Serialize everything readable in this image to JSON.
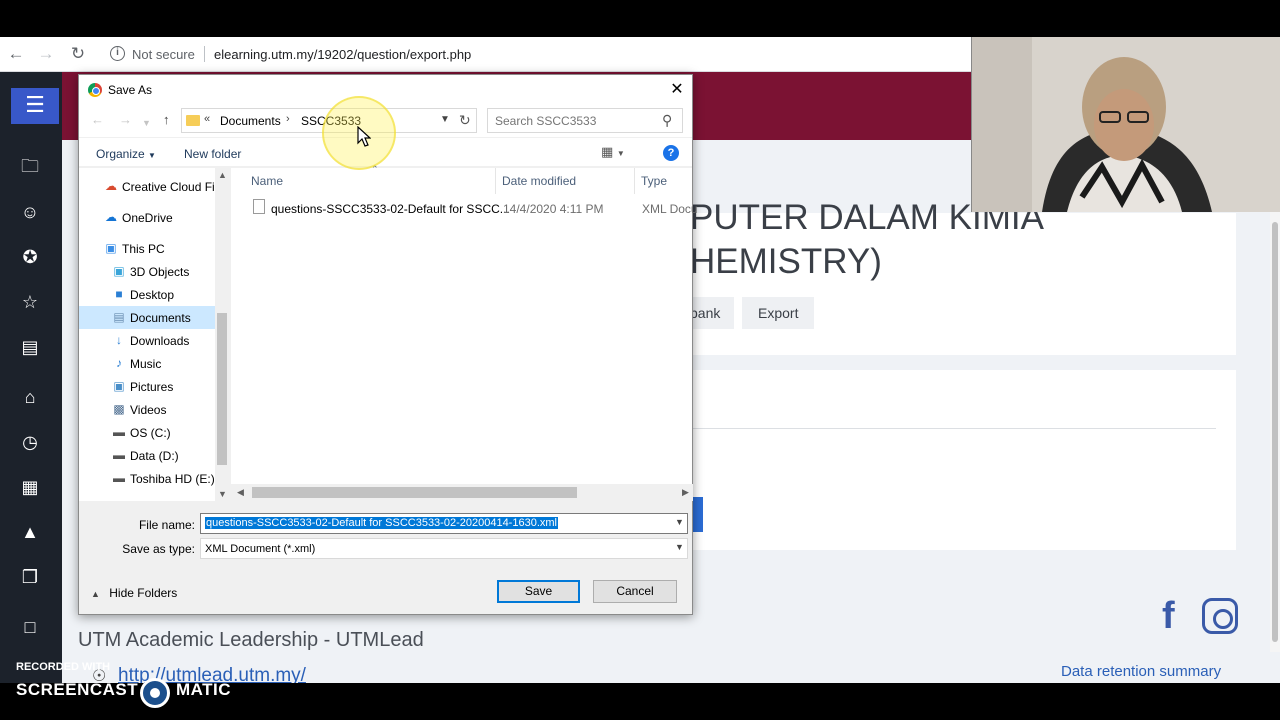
{
  "browser": {
    "back_icon": "back-arrow-icon",
    "forward_icon": "forward-arrow-icon",
    "reload_icon": "reload-icon",
    "security_label": "Not secure",
    "url": "elearning.utm.my/19202/question/export.php"
  },
  "site": {
    "header_color": "#7b1233",
    "course_title_line1": "PUTER DALAM KIMIA",
    "course_title_line2": "HEMISTRY)",
    "breadcrumb_bank": "bank",
    "breadcrumb_export": "Export",
    "footer_title": "UTM Academic Leadership - UTMLead",
    "footer_link": "http://utmlead.utm.my/",
    "data_retention": "Data retention summary",
    "rail_icons": [
      "folder-icon",
      "user-search-icon",
      "badge-icon",
      "star-icon",
      "book-icon",
      "home-icon",
      "dashboard-icon",
      "calendar-icon",
      "graduation-icon",
      "copy-icon",
      "folder-icon"
    ]
  },
  "dialog": {
    "title": "Save As",
    "path": {
      "chevrons": "«",
      "crumb1": "Documents",
      "separator": "›",
      "crumb2": "SSCC3533"
    },
    "search_placeholder": "Search SSCC3533",
    "toolbar": {
      "organize": "Organize",
      "new_folder": "New folder",
      "help": "?"
    },
    "nav_items": [
      {
        "label": "Creative Cloud Fil",
        "icon": "creative-cloud-icon"
      },
      {
        "label": "OneDrive",
        "icon": "onedrive-icon"
      },
      {
        "label": "This PC",
        "icon": "computer-icon"
      },
      {
        "label": "3D Objects",
        "icon": "cube-icon"
      },
      {
        "label": "Desktop",
        "icon": "desktop-icon"
      },
      {
        "label": "Documents",
        "icon": "document-icon"
      },
      {
        "label": "Downloads",
        "icon": "download-icon"
      },
      {
        "label": "Music",
        "icon": "music-icon"
      },
      {
        "label": "Pictures",
        "icon": "pictures-icon"
      },
      {
        "label": "Videos",
        "icon": "videos-icon"
      },
      {
        "label": "OS (C:)",
        "icon": "drive-icon"
      },
      {
        "label": "Data (D:)",
        "icon": "drive-icon"
      },
      {
        "label": "Toshiba HD (E:)",
        "icon": "drive-icon"
      }
    ],
    "columns": {
      "name": "Name",
      "date": "Date modified",
      "type": "Type"
    },
    "files": [
      {
        "name": "questions-SSCC3533-02-Default for SSCC...",
        "date": "14/4/2020 4:11 PM",
        "type": "XML Docu"
      }
    ],
    "file_name_label": "File name:",
    "file_name_value": "questions-SSCC3533-02-Default for SSCC3533-02-20200414-1630.xml",
    "save_type_label": "Save as type:",
    "save_type_value": "XML Document (*.xml)",
    "hide_folders": "Hide Folders",
    "save_button": "Save",
    "cancel_button": "Cancel"
  },
  "watermark": {
    "recorded_with": "RECORDED WITH",
    "brand_left": "SCREENCAST",
    "brand_right": "MATIC"
  }
}
